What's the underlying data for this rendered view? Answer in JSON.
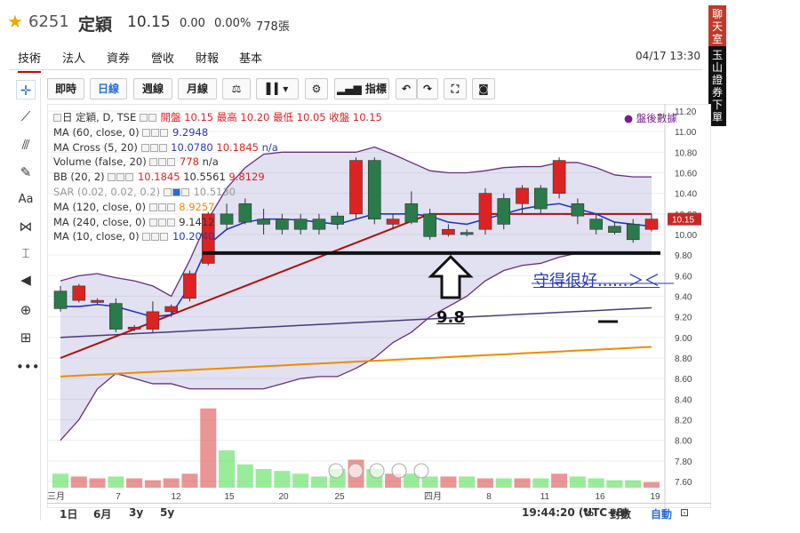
{
  "header": {
    "code": "6251",
    "name": "定穎",
    "price": "10.15",
    "change": "0.00",
    "change_pct": "0.00%",
    "volume": "778張"
  },
  "tabs": [
    {
      "label": "技術",
      "active": true
    },
    {
      "label": "法人"
    },
    {
      "label": "資券"
    },
    {
      "label": "營收"
    },
    {
      "label": "財報"
    },
    {
      "label": "基本"
    }
  ],
  "datetime": "04/17 13:30",
  "side_buttons": {
    "chat": "聊天室",
    "order": "玉山證券下單"
  },
  "toolbar": {
    "intraday": "即時",
    "daily": "日線",
    "weekly": "週線",
    "monthly": "月線",
    "indicators": "指標"
  },
  "legend": [
    {
      "label": "日 定穎, D, TSE",
      "extra": "開盤 10.15 最高 10.20 最低 10.05 收盤 10.15"
    },
    {
      "label": "MA (60, close, 0)",
      "v1": "9.2948"
    },
    {
      "label": "MA Cross (5, 20)",
      "v1": "10.0780",
      "v2": "10.1845",
      "v3": "n/a"
    },
    {
      "label": "Volume (false, 20)",
      "v1": "778",
      "v2": "n/a"
    },
    {
      "label": "BB (20, 2)",
      "v1": "10.1845",
      "v2": "10.5561",
      "v3": "9.8129"
    },
    {
      "label": "SAR (0.02, 0.02, 0.2)",
      "v1": "10.5130"
    },
    {
      "label": "MA (120, close, 0)",
      "v1": "8.9257"
    },
    {
      "label": "MA (240, close, 0)",
      "v1": "9.1412"
    },
    {
      "label": "MA (10, close, 0)",
      "v1": "10.2040"
    }
  ],
  "after_hours": "盤後數據",
  "yaxis": [
    "11.20",
    "11.00",
    "10.80",
    "10.60",
    "10.40",
    "10.20",
    "10.00",
    "9.80",
    "9.60",
    "9.40",
    "9.20",
    "9.00",
    "8.80",
    "8.60",
    "8.40",
    "8.20",
    "8.00",
    "7.80",
    "7.60"
  ],
  "current_price_tag": "10.15",
  "xaxis": [
    "三月",
    "7",
    "12",
    "15",
    "20",
    "25",
    "四月",
    "8",
    "11",
    "16",
    "19"
  ],
  "annotation_text": "守得很好......＞＜",
  "support_label": "9.8",
  "bottom": {
    "r1d": "1日",
    "r6m": "6月",
    "r3y": "3y",
    "r5y": "5y",
    "time": "19:44:20 (UTC+8)",
    "pct": "%",
    "log": "對數",
    "auto": "自動"
  },
  "chart_data": {
    "type": "candlestick",
    "price_range": [
      7.5,
      11.2
    ],
    "candles": [
      {
        "o": 9.45,
        "c": 9.28,
        "h": 9.5,
        "l": 9.25
      },
      {
        "o": 9.36,
        "c": 9.5,
        "h": 9.52,
        "l": 9.34
      },
      {
        "o": 9.34,
        "c": 9.36,
        "h": 9.38,
        "l": 9.32
      },
      {
        "o": 9.33,
        "c": 9.08,
        "h": 9.38,
        "l": 9.05
      },
      {
        "o": 9.08,
        "c": 9.1,
        "h": 9.12,
        "l": 9.06
      },
      {
        "o": 9.08,
        "c": 9.25,
        "h": 9.35,
        "l": 9.05
      },
      {
        "o": 9.25,
        "c": 9.3,
        "h": 9.32,
        "l": 9.2
      },
      {
        "o": 9.38,
        "c": 9.62,
        "h": 9.65,
        "l": 9.35
      },
      {
        "o": 9.72,
        "c": 10.2,
        "h": 10.22,
        "l": 9.7
      },
      {
        "o": 10.2,
        "c": 10.1,
        "h": 10.3,
        "l": 10.05
      },
      {
        "o": 10.3,
        "c": 10.12,
        "h": 10.35,
        "l": 10.1
      },
      {
        "o": 10.15,
        "c": 10.1,
        "h": 10.25,
        "l": 10.0
      },
      {
        "o": 10.15,
        "c": 10.05,
        "h": 10.2,
        "l": 10.0
      },
      {
        "o": 10.15,
        "c": 10.05,
        "h": 10.2,
        "l": 10.0
      },
      {
        "o": 10.15,
        "c": 10.05,
        "h": 10.2,
        "l": 10.0
      },
      {
        "o": 10.18,
        "c": 10.1,
        "h": 10.22,
        "l": 10.05
      },
      {
        "o": 10.2,
        "c": 10.72,
        "h": 10.75,
        "l": 10.15
      },
      {
        "o": 10.72,
        "c": 10.15,
        "h": 10.75,
        "l": 10.1
      },
      {
        "o": 10.1,
        "c": 10.15,
        "h": 10.2,
        "l": 10.05
      },
      {
        "o": 10.3,
        "c": 10.12,
        "h": 10.42,
        "l": 10.1
      },
      {
        "o": 10.2,
        "c": 9.98,
        "h": 10.25,
        "l": 9.95
      },
      {
        "o": 10.0,
        "c": 10.05,
        "h": 10.1,
        "l": 9.98
      },
      {
        "o": 10.02,
        "c": 10.0,
        "h": 10.05,
        "l": 9.98
      },
      {
        "o": 10.05,
        "c": 10.4,
        "h": 10.45,
        "l": 10.0
      },
      {
        "o": 10.35,
        "c": 10.1,
        "h": 10.4,
        "l": 10.05
      },
      {
        "o": 10.3,
        "c": 10.45,
        "h": 10.48,
        "l": 10.2
      },
      {
        "o": 10.45,
        "c": 10.25,
        "h": 10.48,
        "l": 10.2
      },
      {
        "o": 10.4,
        "c": 10.72,
        "h": 10.75,
        "l": 10.35
      },
      {
        "o": 10.3,
        "c": 10.18,
        "h": 10.35,
        "l": 10.1
      },
      {
        "o": 10.15,
        "c": 10.05,
        "h": 10.2,
        "l": 10.0
      },
      {
        "o": 10.08,
        "c": 10.02,
        "h": 10.12,
        "l": 10.0
      },
      {
        "o": 10.1,
        "c": 9.95,
        "h": 10.15,
        "l": 9.92
      },
      {
        "o": 10.05,
        "c": 10.15,
        "h": 10.2,
        "l": 10.03
      }
    ],
    "volumes": [
      0.15,
      0.12,
      0.1,
      0.12,
      0.1,
      0.08,
      0.1,
      0.15,
      0.85,
      0.4,
      0.25,
      0.2,
      0.18,
      0.15,
      0.12,
      0.2,
      0.3,
      0.2,
      0.15,
      0.15,
      0.12,
      0.12,
      0.12,
      0.1,
      0.1,
      0.1,
      0.1,
      0.15,
      0.12,
      0.1,
      0.08,
      0.08,
      0.06
    ]
  }
}
